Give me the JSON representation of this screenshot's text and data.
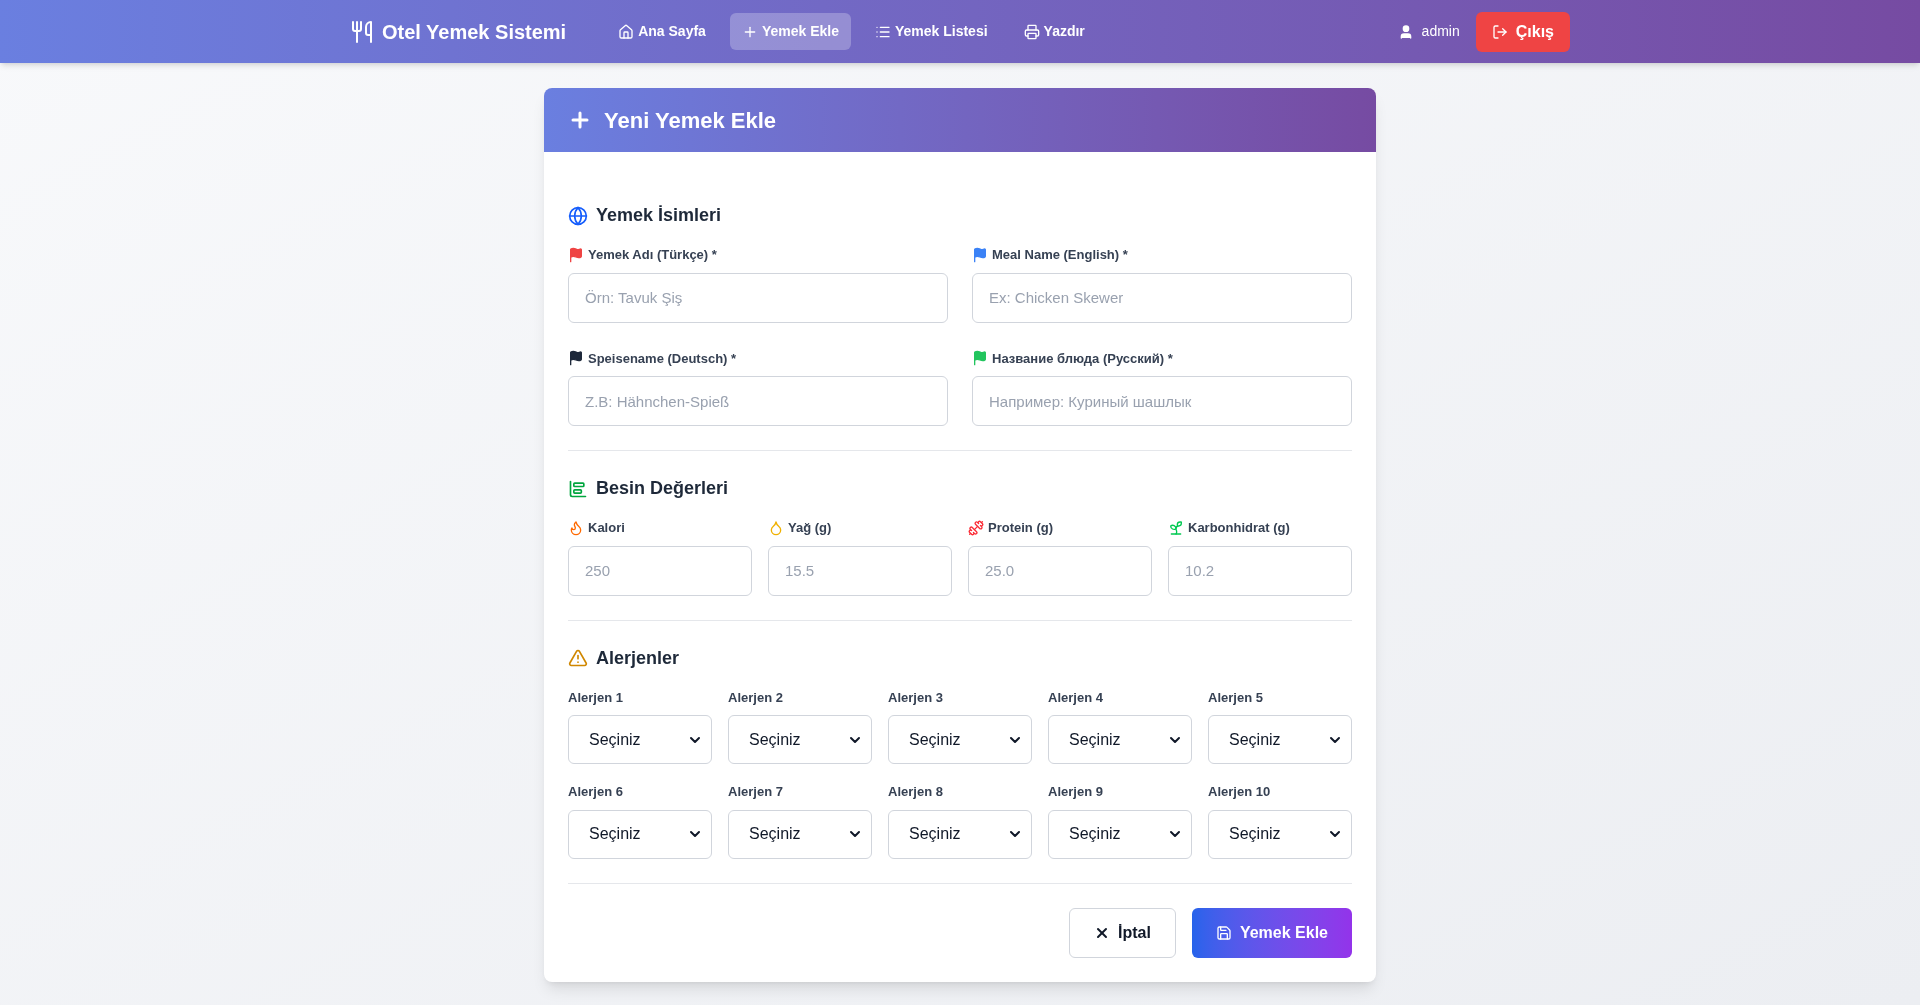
{
  "navbar": {
    "brand": "Otel Yemek Sistemi",
    "links": [
      {
        "label": "Ana Sayfa",
        "kind": "home",
        "selected": false
      },
      {
        "label": "Yemek Ekle",
        "kind": "add",
        "selected": true
      },
      {
        "label": "Yemek Listesi",
        "kind": "list",
        "selected": false
      },
      {
        "label": "Yazdır",
        "kind": "print",
        "selected": false
      }
    ],
    "user": "admin",
    "logout": "Çıkış"
  },
  "card": {
    "title": "Yeni Yemek Ekle",
    "names": {
      "title": "Yemek İsimleri",
      "fields": [
        {
          "label": "Yemek Adı (Türkçe) *",
          "color": "#ef4444",
          "placeholder": "Örn: Tavuk Şiş"
        },
        {
          "label": "Meal Name (English) *",
          "color": "#3b82f6",
          "placeholder": "Ex: Chicken Skewer"
        },
        {
          "label": "Speisename (Deutsch) *",
          "color": "#1e293b",
          "placeholder": "Z.B: Hähnchen-Spieß"
        },
        {
          "label": "Название блюда (Русский) *",
          "color": "#22c55e",
          "placeholder": "Например: Куриный шашлык"
        }
      ]
    },
    "nutrition": {
      "title": "Besin Değerleri",
      "fields": [
        {
          "label": "Kalori",
          "kind": "flame",
          "placeholder": "250"
        },
        {
          "label": "Yağ (g)",
          "kind": "drop",
          "placeholder": "15.5"
        },
        {
          "label": "Protein (g)",
          "kind": "dumbbell",
          "placeholder": "25.0"
        },
        {
          "label": "Karbonhidrat (g)",
          "kind": "sprout",
          "placeholder": "10.2"
        }
      ]
    },
    "allergens": {
      "title": "Alerjenler",
      "fields": [
        {
          "label": "Alerjen 1",
          "value": "Seçiniz"
        },
        {
          "label": "Alerjen 2",
          "value": "Seçiniz"
        },
        {
          "label": "Alerjen 3",
          "value": "Seçiniz"
        },
        {
          "label": "Alerjen 4",
          "value": "Seçiniz"
        },
        {
          "label": "Alerjen 5",
          "value": "Seçiniz"
        },
        {
          "label": "Alerjen 6",
          "value": "Seçiniz"
        },
        {
          "label": "Alerjen 7",
          "value": "Seçiniz"
        },
        {
          "label": "Alerjen 8",
          "value": "Seçiniz"
        },
        {
          "label": "Alerjen 9",
          "value": "Seçiniz"
        },
        {
          "label": "Alerjen 10",
          "value": "Seçiniz"
        }
      ]
    },
    "buttons": {
      "cancel": "İptal",
      "submit": "Yemek Ekle"
    }
  }
}
